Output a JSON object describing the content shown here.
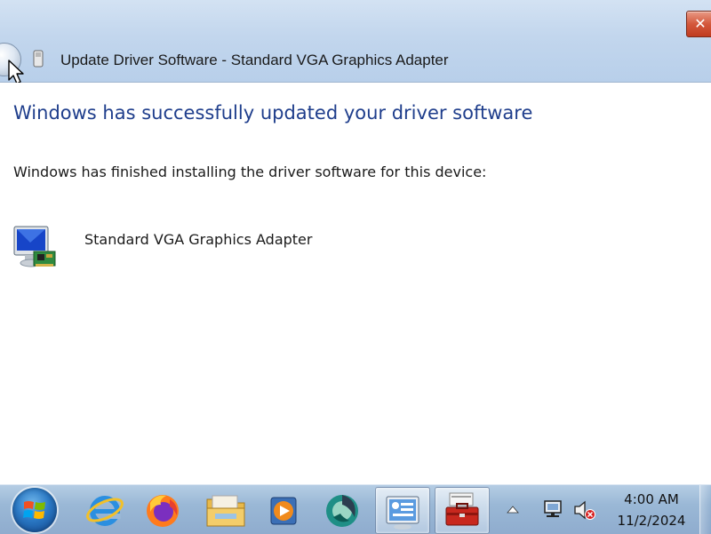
{
  "window": {
    "title": "Update Driver Software - Standard VGA Graphics Adapter",
    "close_label": "✕"
  },
  "content": {
    "headline": "Windows has successfully updated your driver software",
    "message": "Windows has finished installing the driver software for this device:",
    "device_name": "Standard VGA Graphics Adapter"
  },
  "taskbar": {
    "items": [
      {
        "icon": "internet-explorer-icon",
        "active": false
      },
      {
        "icon": "firefox-icon",
        "active": false
      },
      {
        "icon": "file-explorer-icon",
        "active": false
      },
      {
        "icon": "media-player-icon",
        "active": false
      },
      {
        "icon": "app-icon",
        "active": false
      },
      {
        "icon": "control-panel-icon",
        "active": true
      },
      {
        "icon": "toolbox-icon",
        "active": true
      }
    ],
    "clock": {
      "time": "4:00 AM",
      "date": "11/2/2024"
    }
  },
  "colors": {
    "headline": "#1f3e8c",
    "titlebar": "#c2d6ed",
    "taskbar": "#9ab8d6",
    "close_button": "#c03c20"
  }
}
